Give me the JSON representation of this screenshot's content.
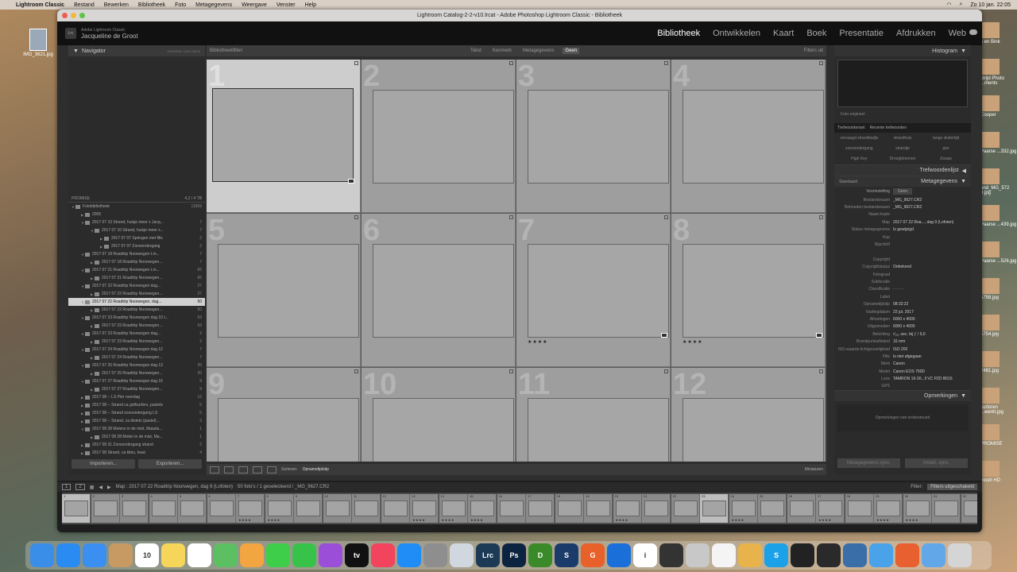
{
  "menubar": {
    "items": [
      "Lightroom Classic",
      "Bestand",
      "Bewerken",
      "Bibliotheek",
      "Foto",
      "Metagegevens",
      "Weergave",
      "Venster",
      "Help"
    ],
    "clock": "Zo 10 jan.  22:05"
  },
  "desktop": {
    "left_icon": "IMG_3621.jpg",
    "right_icons": [
      "s en Bink",
      "strijd Photo ...ments",
      "Cooper",
      "Paarse ...332.jpg",
      "and_MG_572 9.jpg",
      "Paarse ...439.jpg",
      "Paarse ...526.jpg",
      "5758.jpg",
      "5754.jpg",
      "2481.jpg",
      "surtoren ...werkt.jpg",
      "PROMISE",
      "ntosh HD"
    ]
  },
  "window": {
    "title": "Lightroom Catalog-2-2-v10.lrcat - Adobe Photoshop Lightroom Classic - Bibliotheek",
    "identity_small": "Adobe Lightroom Classic",
    "identity_name": "Jacqueline de Groot",
    "logo": "Lrc",
    "modules": [
      "Bibliotheek",
      "Ontwikkelen",
      "Kaart",
      "Boek",
      "Presentatie",
      "Afdrukken",
      "Web"
    ]
  },
  "left": {
    "navigator": "Navigator",
    "nav_options": "PASSEND  100%  300%",
    "volume": "PROMISE",
    "volume_stats": "4,2 / 4 TB",
    "folders": [
      {
        "label": "Fotobibliotheek",
        "count": "11669",
        "depth": 0,
        "open": true
      },
      {
        "label": "2005",
        "count": "",
        "depth": 1,
        "open": false
      },
      {
        "label": "2017 07 10 Strand, huisje meer x Jacq...",
        "count": "7",
        "depth": 1,
        "open": true
      },
      {
        "label": "2017 07 10 Strand, huisje meer x...",
        "count": "7",
        "depth": 2,
        "open": true
      },
      {
        "label": "2017 07 07 Springen met fills",
        "count": "2",
        "depth": 3,
        "open": false
      },
      {
        "label": "2017 07 07 Zonsondergang",
        "count": "2",
        "depth": 3,
        "open": false
      },
      {
        "label": "2017 07 18 Roadtrip Noorwegen t.m...",
        "count": "7",
        "depth": 1,
        "open": true
      },
      {
        "label": "2017 07 18 Roadtrip Noorwegen...",
        "count": "7",
        "depth": 2,
        "open": false
      },
      {
        "label": "2017 07 21 Roadtrip Noorwegen t.m...",
        "count": "65",
        "depth": 1,
        "open": true
      },
      {
        "label": "2017 07 21 Roadtrip Noorwegen...",
        "count": "65",
        "depth": 2,
        "open": false
      },
      {
        "label": "2017 07 22 Roadtrip Noorwegen dag...",
        "count": "27",
        "depth": 1,
        "open": true
      },
      {
        "label": "2017 07 22 Roadtrip Noorwegen...",
        "count": "27",
        "depth": 2,
        "open": false
      },
      {
        "label": "2017 07 22 Roadtrip Noorwegen, dag...",
        "count": "50",
        "depth": 1,
        "open": true,
        "selected": true
      },
      {
        "label": "2017 07 22 Roadtrip Noorwegen...",
        "count": "50",
        "depth": 2,
        "open": false
      },
      {
        "label": "2017 07 23 Roadtrip Noorwegen dag 10 t...",
        "count": "53",
        "depth": 1,
        "open": true
      },
      {
        "label": "2017 07 23 Roadtrip Noorwegen...",
        "count": "53",
        "depth": 2,
        "open": false
      },
      {
        "label": "2017 07 23 Roadtrip Noorwegen dag...",
        "count": "2",
        "depth": 1,
        "open": true
      },
      {
        "label": "2017 07 23 Roadtrip Noorwegen...",
        "count": "2",
        "depth": 2,
        "open": false
      },
      {
        "label": "2017 07 24 Roadtrip Noorwegen dag 12",
        "count": "7",
        "depth": 1,
        "open": true
      },
      {
        "label": "2017 07 24 Roadtrip Noorwegen...",
        "count": "7",
        "depth": 2,
        "open": false
      },
      {
        "label": "2017 07 25 Roadtrip Noorwegen dag 13",
        "count": "20",
        "depth": 1,
        "open": true
      },
      {
        "label": "2017 07 25 Roadtrip Noorwegen...",
        "count": "20",
        "depth": 2,
        "open": false
      },
      {
        "label": "2017 07 27 Roadtrip Noorwegen dag 15",
        "count": "9",
        "depth": 1,
        "open": true
      },
      {
        "label": "2017 07 27 Roadtrip Noorwegen...",
        "count": "9",
        "depth": 2,
        "open": false
      },
      {
        "label": "2017 08 -- LS Pier overdag",
        "count": "12",
        "depth": 1,
        "open": false
      },
      {
        "label": "2017 08 -- Strand ca golfsurfers, pastels",
        "count": "5",
        "depth": 1,
        "open": false
      },
      {
        "label": "2017 08 -- Strand zonsondergang LS",
        "count": "5",
        "depth": 1,
        "open": false
      },
      {
        "label": "2017 08 -- Strand, ca distels (pastel)...",
        "count": "3",
        "depth": 1,
        "open": false
      },
      {
        "label": "2017 08 28 Molens in de mist, Maasla...",
        "count": "1",
        "depth": 1,
        "open": true
      },
      {
        "label": "2017 08 28 Molen in de mist, Ma...",
        "count": "1",
        "depth": 2,
        "open": false
      },
      {
        "label": "2017 08 31 Zonsondergang strand",
        "count": "2",
        "depth": 1,
        "open": false
      },
      {
        "label": "2017 08 Strand, ca kites, kwal",
        "count": "4",
        "depth": 1,
        "open": false
      }
    ],
    "import": "Importeren...",
    "export": "Exporteren..."
  },
  "center": {
    "filter_label": "Bibliotheekfilter:",
    "filter_opts": [
      "Tekst",
      "Kenmerk",
      "Metagegevens",
      "Geen"
    ],
    "filter_active": "Geen",
    "filter_right": "Filters uit",
    "cells": [
      {
        "n": "1",
        "stars": "",
        "selected": true
      },
      {
        "n": "2",
        "stars": ""
      },
      {
        "n": "3",
        "stars": ""
      },
      {
        "n": "4",
        "stars": ""
      },
      {
        "n": "5",
        "stars": ""
      },
      {
        "n": "6",
        "stars": ""
      },
      {
        "n": "7",
        "stars": "★★★★",
        "badge": true
      },
      {
        "n": "8",
        "stars": "★★★★",
        "badge": true
      },
      {
        "n": "9",
        "stars": ""
      },
      {
        "n": "10",
        "stars": ""
      },
      {
        "n": "11",
        "stars": ""
      },
      {
        "n": "12",
        "stars": ""
      }
    ],
    "sort_label": "Sorteren:",
    "sort_value": "Opnametijdstip",
    "thumbs_label": "Miniaturen"
  },
  "right": {
    "histogram": "Histogram",
    "original": "Foto-origineel",
    "kw_set_label": "Trefwoordenset",
    "kw_set_value": "Recente trefwoorden",
    "keywords": [
      "vervaagd strandbadje",
      "strandhuis",
      "lange sluitertijd",
      "zonsondergang",
      "strandje",
      "pier",
      "High Key",
      "Droogbloemen",
      "Zwaan"
    ],
    "keyword_list": "Trefwoordenlijst",
    "metadata": "Metagegevens",
    "meta_preset_label": "Standaard",
    "preset_label": "Voorinstelling",
    "preset_value": "Geen",
    "meta": [
      {
        "k": "Bestandsnaam",
        "v": "_MG_9627.CR2"
      },
      {
        "k": "Behouden bestandsnaam",
        "v": "_MG_9627.CR2"
      },
      {
        "k": "Naam kopie",
        "v": ""
      },
      {
        "k": "Map",
        "v": "2017 07 22 Roa..., dag 9 (Lofoten)"
      },
      {
        "k": "Status metagegevens",
        "v": "Is gewijzigd"
      },
      {
        "k": "Kop",
        "v": ""
      },
      {
        "k": "Bijschrift",
        "v": ""
      },
      {
        "k": "",
        "v": ""
      },
      {
        "k": "Copyright",
        "v": ""
      },
      {
        "k": "Copyrightstatus",
        "v": "Onbekend"
      },
      {
        "k": "Fotograaf",
        "v": ""
      },
      {
        "k": "Sublocatie",
        "v": ""
      },
      {
        "k": "Classificatie",
        "v": "· · · · ·"
      },
      {
        "k": "Label",
        "v": ""
      },
      {
        "k": "Opnametijdstip",
        "v": "08:32:22"
      },
      {
        "k": "Vastlegdatum",
        "v": "22 jul. 2017"
      },
      {
        "k": "Afmetingen",
        "v": "6000 x 4000"
      },
      {
        "k": "Uitgesneden",
        "v": "6000 x 4000"
      },
      {
        "k": "Belichting",
        "v": "¹⁄₁₅₀ sec. bij ƒ / 9,0"
      },
      {
        "k": "Brandpuntsafstand",
        "v": "16 mm"
      },
      {
        "k": "ISO-waarde-lichtgevoeligheid",
        "v": "ISO 200"
      },
      {
        "k": "Flits",
        "v": "Is niet afgegaan"
      },
      {
        "k": "Merk",
        "v": "Canon"
      },
      {
        "k": "Model",
        "v": "Canon EOS 760D"
      },
      {
        "k": "Lens",
        "v": "TAMRON 16-30...ll VC PZD B016"
      },
      {
        "k": "GPS",
        "v": ""
      }
    ],
    "comments": "Opmerkingen",
    "comments_placeholder": "Opmerkingen niet ondersteund",
    "sync_meta": "Metagegevens sync.",
    "sync_settings": "Instell. sync."
  },
  "filmstrip": {
    "pages": [
      "1",
      "2"
    ],
    "path": "Map : 2017 07 22 Roadtrip Noorwegen, dag 9 (Lofoten)",
    "count": "50 foto's / 1 geselecteerd / _MG_9627.CR2",
    "filter_label": "Filter:",
    "filter_value": "Filters uitgeschakeld",
    "cells": [
      {
        "n": "1",
        "stars": "",
        "sel": true
      },
      {
        "n": "2",
        "stars": ""
      },
      {
        "n": "3",
        "stars": ""
      },
      {
        "n": "4",
        "stars": ""
      },
      {
        "n": "5",
        "stars": ""
      },
      {
        "n": "6",
        "stars": ""
      },
      {
        "n": "7",
        "stars": "★★★★"
      },
      {
        "n": "8",
        "stars": "★★★★"
      },
      {
        "n": "9",
        "stars": ""
      },
      {
        "n": "10",
        "stars": ""
      },
      {
        "n": "11",
        "stars": ""
      },
      {
        "n": "12",
        "stars": ""
      },
      {
        "n": "13",
        "stars": "★★★★"
      },
      {
        "n": "14",
        "stars": "★★★★"
      },
      {
        "n": "15",
        "stars": "★★★★"
      },
      {
        "n": "16",
        "stars": ""
      },
      {
        "n": "17",
        "stars": ""
      },
      {
        "n": "18",
        "stars": ""
      },
      {
        "n": "19",
        "stars": ""
      },
      {
        "n": "20",
        "stars": "★★★★"
      },
      {
        "n": "21",
        "stars": ""
      },
      {
        "n": "22",
        "stars": ""
      },
      {
        "n": "23",
        "stars": "",
        "sel": true
      },
      {
        "n": "24",
        "stars": "★★★★"
      },
      {
        "n": "25",
        "stars": ""
      },
      {
        "n": "26",
        "stars": ""
      },
      {
        "n": "27",
        "stars": "★★★★"
      },
      {
        "n": "28",
        "stars": ""
      },
      {
        "n": "29",
        "stars": "★★★★"
      },
      {
        "n": "30",
        "stars": "★★★★"
      },
      {
        "n": "31",
        "stars": ""
      },
      {
        "n": "32",
        "stars": ""
      }
    ]
  },
  "dock": {
    "items": [
      {
        "name": "finder-icon",
        "label": "",
        "color": "#3b8ee8"
      },
      {
        "name": "safari-icon",
        "label": "",
        "color": "#2a8bf2"
      },
      {
        "name": "mail-icon",
        "label": "",
        "color": "#3a8ff0"
      },
      {
        "name": "contacts-icon",
        "label": "",
        "color": "#c79a63"
      },
      {
        "name": "calendar-icon",
        "label": "10",
        "color": "#ffffff"
      },
      {
        "name": "notes-icon",
        "label": "",
        "color": "#f5d65a"
      },
      {
        "name": "reminders-icon",
        "label": "",
        "color": "#ffffff"
      },
      {
        "name": "maps-icon",
        "label": "",
        "color": "#5cbf62"
      },
      {
        "name": "photos-icon",
        "label": "",
        "color": "#f2a541"
      },
      {
        "name": "messages-icon",
        "label": "",
        "color": "#3fce4a"
      },
      {
        "name": "facetime-icon",
        "label": "",
        "color": "#37c34a"
      },
      {
        "name": "podcasts-icon",
        "label": "",
        "color": "#9b4fd8"
      },
      {
        "name": "tv-icon",
        "label": "tv",
        "color": "#111111"
      },
      {
        "name": "music-icon",
        "label": "",
        "color": "#f2445c"
      },
      {
        "name": "appstore-icon",
        "label": "",
        "color": "#1f8df5"
      },
      {
        "name": "settings-icon",
        "label": "",
        "color": "#8e8e8e"
      },
      {
        "name": "preview-icon",
        "label": "",
        "color": "#d0d7de"
      },
      {
        "name": "lightroom-icon",
        "label": "Lrc",
        "color": "#1c3a55"
      },
      {
        "name": "photoshop-icon",
        "label": "Ps",
        "color": "#0c2440"
      },
      {
        "name": "dxo-icon",
        "label": "D",
        "color": "#3a8a2a"
      },
      {
        "name": "s-app-icon",
        "label": "S",
        "color": "#1b3b6b"
      },
      {
        "name": "g-app-icon",
        "label": "G",
        "color": "#e8602a"
      },
      {
        "name": "teamviewer-icon",
        "label": "",
        "color": "#1a6fd8"
      },
      {
        "name": "info-icon",
        "label": "i",
        "color": "#ffffff"
      },
      {
        "name": "printer-icon",
        "label": "",
        "color": "#333333"
      },
      {
        "name": "network-icon",
        "label": "",
        "color": "#c8c8c8"
      },
      {
        "name": "colors-icon",
        "label": "",
        "color": "#f4f4f4"
      },
      {
        "name": "paint-icon",
        "label": "",
        "color": "#e8b34a"
      },
      {
        "name": "skype-icon",
        "label": "S",
        "color": "#1aa1e8"
      },
      {
        "name": "terminal-icon",
        "label": "",
        "color": "#222222"
      },
      {
        "name": "printer2-icon",
        "label": "",
        "color": "#2a2a2a"
      },
      {
        "name": "remote-icon",
        "label": "",
        "color": "#3a6ea8"
      },
      {
        "name": "folder-icon",
        "label": "",
        "color": "#4aa3e8"
      },
      {
        "name": "browser-icon",
        "label": "",
        "color": "#e86030"
      },
      {
        "name": "downloads-icon",
        "label": "",
        "color": "#62a8e8"
      },
      {
        "name": "trash-icon",
        "label": "",
        "color": "#d5d5d5"
      }
    ]
  }
}
